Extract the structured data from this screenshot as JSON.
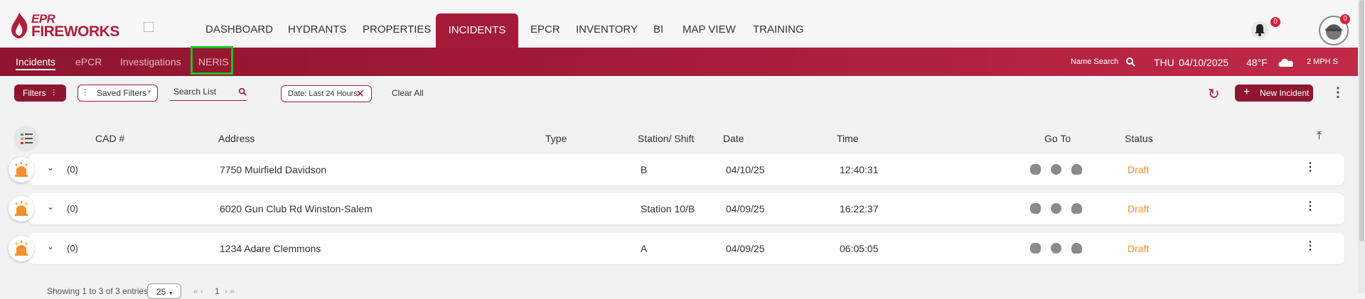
{
  "brand": {
    "line1": "EPR",
    "line2": "FIREWORKS",
    "color": "#b01e3c"
  },
  "topnav": {
    "items": [
      "DASHBOARD",
      "HYDRANTS",
      "PROPERTIES",
      "INCIDENTS",
      "EPCR",
      "INVENTORY",
      "BI",
      "MAP VIEW",
      "TRAINING"
    ],
    "active": "INCIDENTS",
    "notification_count": "0",
    "profile_count": "0"
  },
  "subnav": {
    "items": [
      "Incidents",
      "ePCR",
      "Investigations",
      "NERIS"
    ],
    "active": "Incidents",
    "highlighted": "NERIS",
    "name_search": "Name Search",
    "day": "THU",
    "date": "04/10/2025",
    "temperature": "48°F",
    "wind": "2 MPH S"
  },
  "toolbar": {
    "filters_label": "Filters",
    "saved_filters_label": "Saved Filters",
    "search_placeholder": "Search List",
    "chip_label": "Date: Last 24 Hours",
    "clear_all": "Clear All",
    "new_incident": "New Incident"
  },
  "table": {
    "headers": {
      "cad": "CAD #",
      "address": "Address",
      "type": "Type",
      "station": "Station/ Shift",
      "date": "Date",
      "time": "Time",
      "goto": "Go To",
      "status": "Status"
    },
    "rows": [
      {
        "cad": "(0)",
        "address": "7750 Muirfield Davidson",
        "type": "",
        "station": "B",
        "date": "04/10/25",
        "time": "12:40:31",
        "status": "Draft"
      },
      {
        "cad": "(0)",
        "address": "6020 Gun Club Rd Winston-Salem",
        "type": "",
        "station": "Station 10/B",
        "date": "04/09/25",
        "time": "16:22:37",
        "status": "Draft"
      },
      {
        "cad": "(0)",
        "address": "1234 Adare Clemmons",
        "type": "",
        "station": "A",
        "date": "04/09/25",
        "time": "06:05:05",
        "status": "Draft"
      }
    ]
  },
  "footer": {
    "showing": "Showing 1 to 3 of 3 entries",
    "page_size": "25",
    "current_page": "1"
  },
  "colors": {
    "accent": "#a31b39",
    "draft": "#f0912e",
    "highlight": "#19c419"
  }
}
